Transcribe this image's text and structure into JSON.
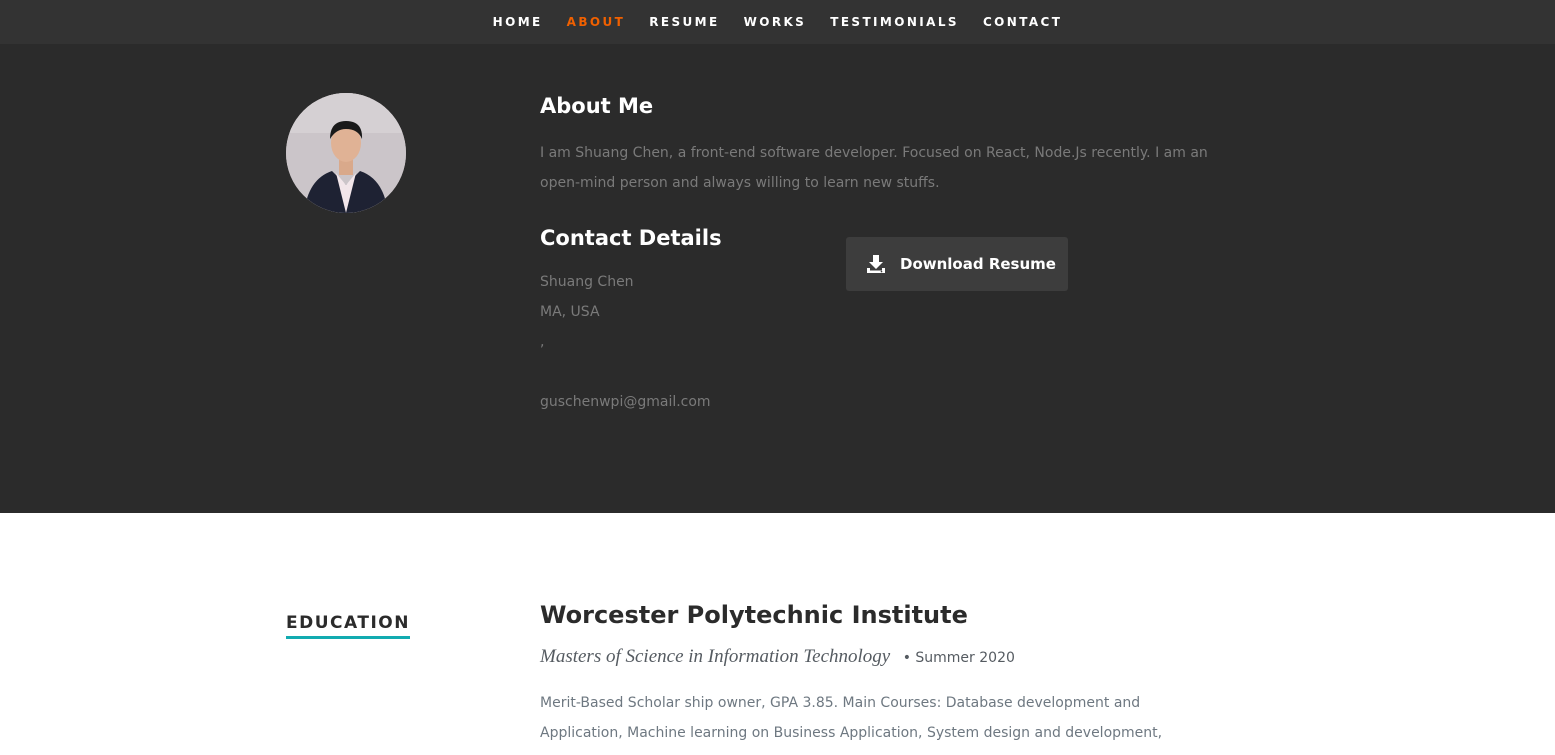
{
  "nav": {
    "items": [
      {
        "label": "HOME"
      },
      {
        "label": "ABOUT"
      },
      {
        "label": "RESUME"
      },
      {
        "label": "WORKS"
      },
      {
        "label": "TESTIMONIALS"
      },
      {
        "label": "CONTACT"
      }
    ],
    "active": "ABOUT"
  },
  "about": {
    "title": "About Me",
    "text": "I am Shuang Chen, a front-end software developer. Focused on React, Node.Js recently. I am an open-mind person and always willing to learn new stuffs.",
    "contact_title": "Contact Details",
    "name": "Shuang Chen",
    "location": "MA, USA",
    "separator": ",",
    "email": "guschenwpi@gmail.com",
    "download_label": "Download Resume"
  },
  "education": {
    "heading": "EDUCATION",
    "school": "Worcester Polytechnic Institute",
    "degree": "Masters of Science in Information Technology",
    "date": "• Summer 2020",
    "description": "Merit-Based Scholar ship owner, GPA 3.85. Main Courses: Database development and Application, Machine learning on Business Application, System design and development,"
  },
  "colors": {
    "accent": "#f06000",
    "underline": "#11abb0",
    "nav_bg": "#333333",
    "about_bg": "#2b2b2b"
  },
  "icons": {
    "download": "download-icon",
    "avatar": "avatar-photo"
  }
}
